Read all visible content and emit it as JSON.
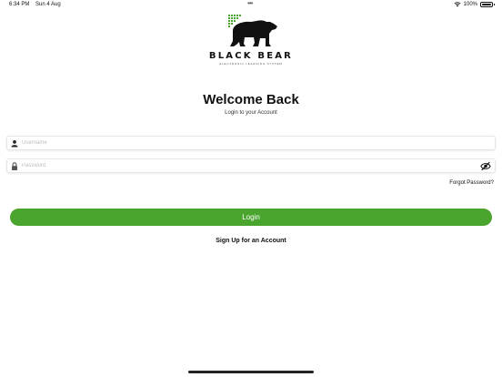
{
  "status_bar": {
    "time": "6:34 PM",
    "date": "Sun 4 Aug",
    "battery_text": "100%",
    "battery_level": 1.0,
    "wifi_icon": "wifi-icon",
    "multitask": "•••"
  },
  "brand": {
    "name": "BLACK BEAR",
    "tagline": "ELECTRONIC LEARNING SYSTEM",
    "accent_color": "#4aa52e"
  },
  "header": {
    "title": "Welcome Back",
    "subtitle": "Login to your Account"
  },
  "form": {
    "username": {
      "value": "",
      "placeholder": "Username",
      "icon": "person-icon"
    },
    "password": {
      "value": "",
      "placeholder": "Password",
      "icon": "lock-icon",
      "toggle_icon": "eye-slash-icon"
    },
    "forgot_label": "Forgot Password?",
    "login_label": "Login",
    "signup_label": "Sign Up for an Account"
  }
}
